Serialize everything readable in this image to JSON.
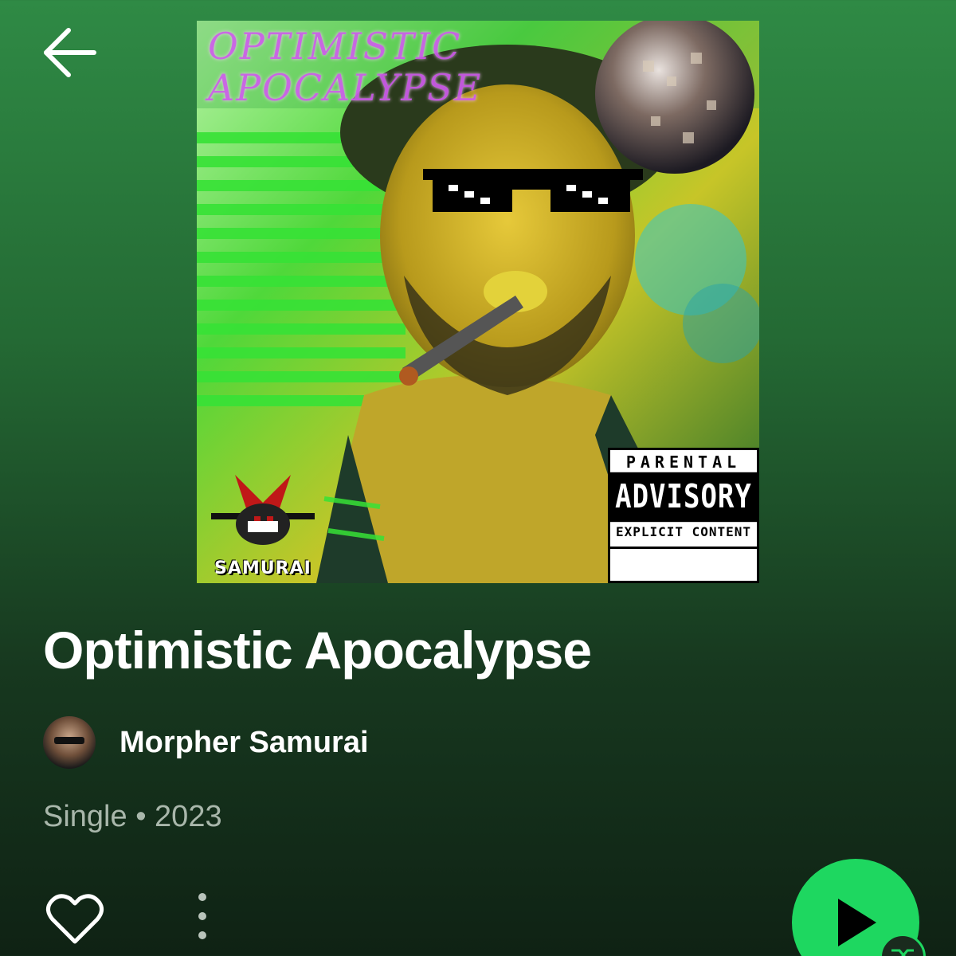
{
  "album": {
    "title": "Optimistic Apocalypse",
    "artist": "Morpher Samurai",
    "meta": "Single • 2023"
  },
  "cover": {
    "title_line1": "OPTIMISTIC",
    "title_line2": "APOCALYPSE",
    "badge_text": "SAMURAI",
    "advisory_top": "PARENTAL",
    "advisory_middle": "ADVISORY",
    "advisory_bottom": "EXPLICIT CONTENT"
  },
  "icons": {
    "back": "arrow-left-icon",
    "like": "heart-outline-icon",
    "more": "vertical-dots-icon",
    "play": "play-icon",
    "shuffle": "shuffle-icon"
  },
  "colors": {
    "accent": "#1ed760",
    "background_top": "#2f8a45",
    "background_bottom": "#0f2214",
    "meta_text": "#a9b7ab"
  }
}
